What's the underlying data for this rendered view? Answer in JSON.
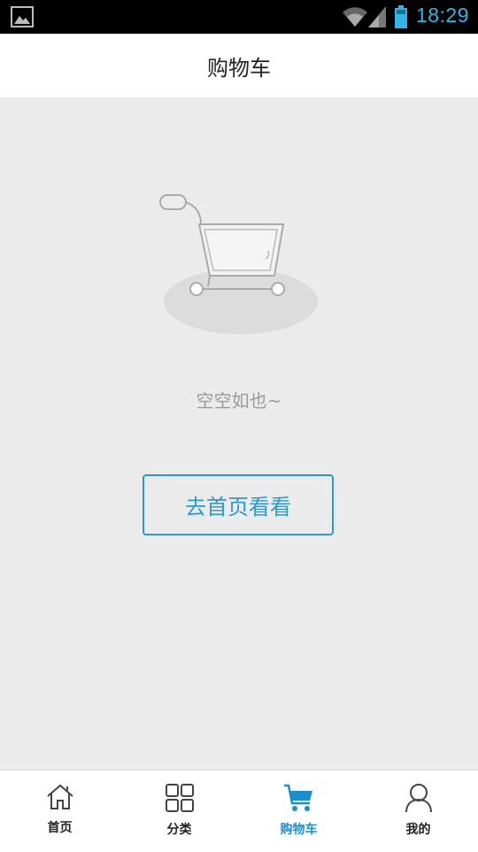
{
  "status_bar": {
    "time": "18:29"
  },
  "header": {
    "title": "购物车"
  },
  "empty_state": {
    "message": "空空如也~",
    "button_label": "去首页看看"
  },
  "tabs": [
    {
      "label": "首页",
      "icon": "home-icon",
      "active": false
    },
    {
      "label": "分类",
      "icon": "grid-icon",
      "active": false
    },
    {
      "label": "购物车",
      "icon": "cart-icon",
      "active": true
    },
    {
      "label": "我的",
      "icon": "person-icon",
      "active": false
    }
  ],
  "colors": {
    "accent": "#1a8fd0",
    "status_clock": "#33b5e5",
    "background": "#ebebeb"
  }
}
